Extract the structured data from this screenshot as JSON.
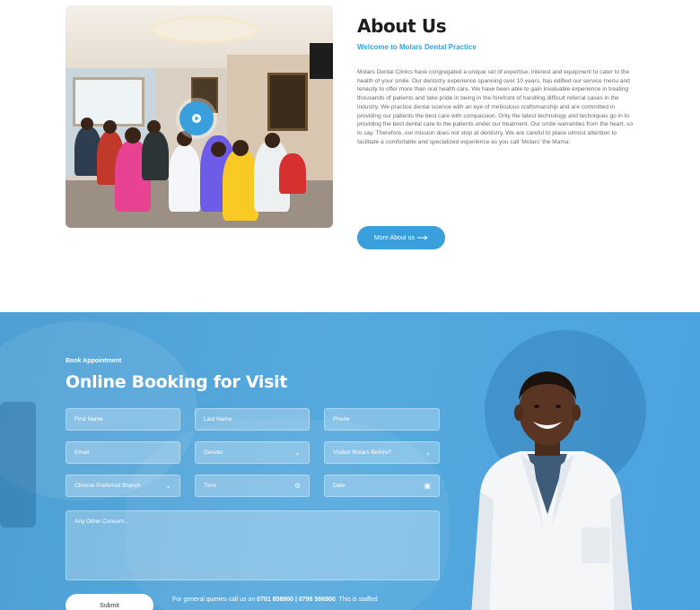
{
  "about": {
    "title": "About Us",
    "subtitle": "Welcome to Molars Dental Practice",
    "body": "Molars Dental Clinics have congregated a unique set of expertise, interest and equipment to cater to the health of your smile. Our dentistry experience spanning over 10 years, has edified our service menu and tenacity to offer more than oral health care. We have been able to gain invaluable experience in treating thousands of patients and take pride in being in the forefront of handling difficult referral cases in the industry. We practice dental science with an eye of meticulous craftsmanship and are committed in providing our patients the best care with compassion. Only the latest technology and techniques go in to providing the best dental care to the patients under our treatment. Our smile warranties from the heart, so to say. Therefore, our mission does not stop at dentistry. We are careful to place utmost attention to facilitate a comfortable and specialized experience as you call 'Molars' the Mama'.",
    "button_label": "More About us",
    "button_icon": "arrow-right-icon",
    "play_icon": "play-icon"
  },
  "booking": {
    "label": "Book Appointment",
    "title": "Online Booking for Visit",
    "fields": {
      "first_name": "First Name",
      "last_name": "Last Name",
      "phone": "Phone",
      "email": "Email",
      "gender": "Gender",
      "visited_before": "Visited Molars Before?",
      "branch": "Choose Preferred Branch",
      "time": "Time",
      "date": "Date",
      "concern": "Any Other Concern..."
    },
    "submit_label": "Submit",
    "note_prefix": "For general queries call us on ",
    "note_numbers": "0701 858900 | 0796 586900",
    "note_suffix": ". This is staffed"
  },
  "colors": {
    "accent": "#3aa0dd",
    "booking_bg": "#4ba3de"
  }
}
